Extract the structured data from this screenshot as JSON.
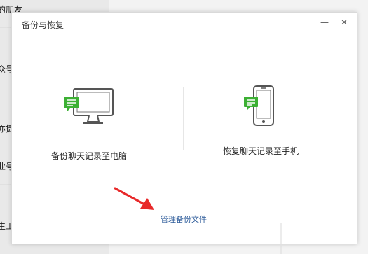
{
  "background": {
    "items": [
      {
        "label": "的朋友"
      },
      {
        "label": "众号"
      },
      {
        "label": "亦捷"
      },
      {
        "label": "业号"
      },
      {
        "label": "生工"
      }
    ]
  },
  "dialog": {
    "title": "备份与恢复",
    "minimize_symbol": "—",
    "close_symbol": "✕",
    "options": {
      "backup_to_pc": {
        "label": "备份聊天记录至电脑",
        "icon": "monitor-chat-icon"
      },
      "restore_to_phone": {
        "label": "恢复聊天记录至手机",
        "icon": "phone-chat-icon"
      }
    },
    "manage_link": "管理备份文件"
  },
  "annotation": {
    "arrow_color": "#e8292a"
  },
  "colors": {
    "accent_green": "#3cb034",
    "link_blue": "#2f5d9b"
  }
}
